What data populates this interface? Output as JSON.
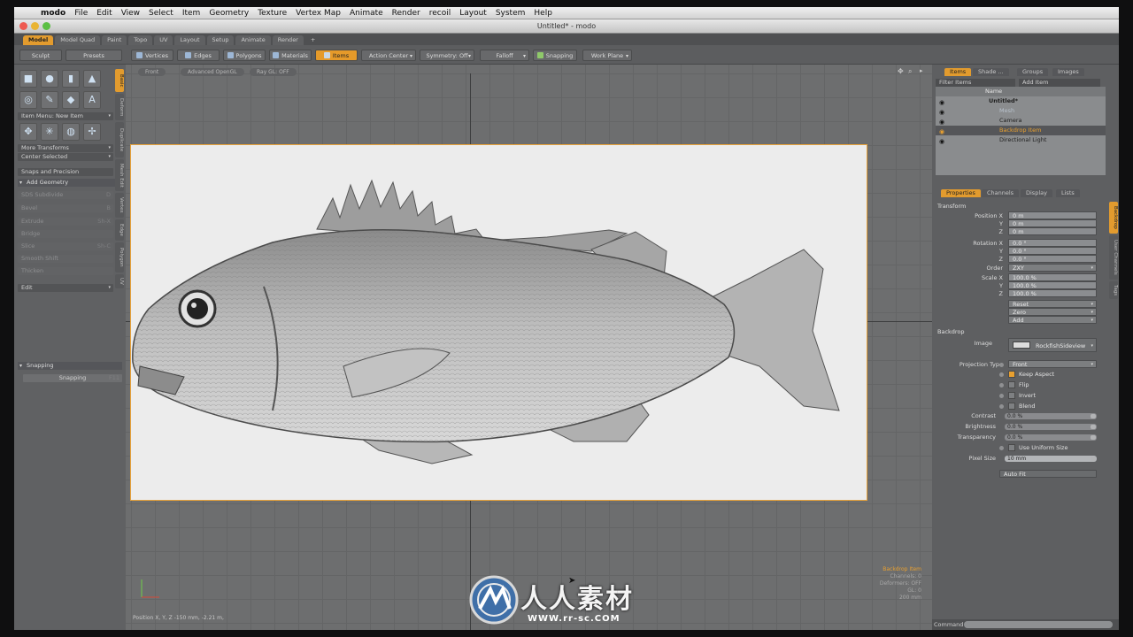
{
  "menubar": {
    "app_name": "modo",
    "items": [
      "File",
      "Edit",
      "View",
      "Select",
      "Item",
      "Geometry",
      "Texture",
      "Vertex Map",
      "Animate",
      "Render",
      "recoil",
      "Layout",
      "System",
      "Help"
    ]
  },
  "window": {
    "title": "Untitled* - modo"
  },
  "layout_tabs": [
    "Model",
    "Model Quad",
    "Paint",
    "Topo",
    "UV",
    "Layout",
    "Setup",
    "Animate",
    "Render"
  ],
  "layout_tab_add": "+",
  "toolbar": {
    "sculpt": "Sculpt",
    "presets": "Presets",
    "vertices": "Vertices",
    "edges": "Edges",
    "polygons": "Polygons",
    "materials": "Materials",
    "items": "Items",
    "action_center": "Action Center",
    "symmetry": "Symmetry: Off",
    "falloff": "Falloff",
    "snapping": "Snapping",
    "work_plane": "Work Plane"
  },
  "left_panel": {
    "item_menu": "Item Menu: New Item",
    "more_transforms": "More Transforms",
    "center_selected": "Center Selected",
    "snaps": "Snaps and Precision",
    "add_geometry": "Add Geometry",
    "tools": [
      [
        "SDS Subdivide",
        "D"
      ],
      [
        "Bevel",
        "B"
      ],
      [
        "Extrude",
        "Sh-X"
      ],
      [
        "Bridge",
        ""
      ],
      [
        "Slice",
        "Sh-C"
      ],
      [
        "Smooth Shift",
        ""
      ],
      [
        "Thicken",
        ""
      ]
    ],
    "edit": "Edit",
    "snapping_section": "Snapping",
    "snapping_row": "Snapping",
    "snapping_key": "F11",
    "side_tabs": [
      "Basic",
      "Deform",
      "Duplicate",
      "Mesh Edit",
      "Vertex",
      "Edge",
      "Polygon",
      "UV"
    ]
  },
  "viewport": {
    "view": "Front",
    "shading": "Advanced OpenGL",
    "ray": "Ray GL: OFF",
    "info_title": "Backdrop Item",
    "info_lines": [
      "Channels: 0",
      "Deformers: OFF",
      "GL: 0",
      "200 mm"
    ],
    "status": "Position X, Y, Z   -150 mm, -2.21 m,"
  },
  "right_panel": {
    "top_tabs": [
      "Items",
      "Shade ...",
      "Groups",
      "Images"
    ],
    "filter": "Filter Items",
    "add_item": "Add Item",
    "list_header": "Name",
    "items": [
      {
        "name": "Untitled*"
      },
      {
        "name": "Mesh"
      },
      {
        "name": "Camera"
      },
      {
        "name": "Backdrop Item"
      },
      {
        "name": "Directional Light"
      }
    ],
    "prop_tabs": [
      "Properties",
      "Channels",
      "Display",
      "Lists"
    ],
    "transform": "Transform",
    "position_x": "Position X",
    "position_x_val": "0 m",
    "y": "Y",
    "pos_y_val": "0 m",
    "z": "Z",
    "pos_z_val": "0 m",
    "rotation_x": "Rotation X",
    "rot_x_val": "0.0 °",
    "rot_y_val": "0.0 °",
    "rot_z_val": "0.0 °",
    "order": "Order",
    "order_val": "ZXY",
    "scale_x": "Scale X",
    "scale_x_val": "100.0 %",
    "scale_y_val": "100.0 %",
    "scale_z_val": "100.0 %",
    "reset": "Reset",
    "zero": "Zero",
    "add": "Add",
    "backdrop_section": "Backdrop",
    "image_label": "Image",
    "image_val": "RockfishSideview",
    "projection_label": "Projection Type",
    "projection_val": "Front",
    "keep_aspect": "Keep Aspect",
    "flip": "Flip",
    "invert": "Invert",
    "blend": "Blend",
    "contrast": "Contrast",
    "contrast_val": "0.0 %",
    "brightness": "Brightness",
    "brightness_val": "0.0 %",
    "transparency": "Transparency",
    "transparency_val": "0.0 %",
    "use_uniform": "Use Uniform Size",
    "pixel_size": "Pixel Size",
    "pixel_size_val": "10 mm",
    "auto_fit": "Auto Fit",
    "side_tabs": [
      "Backdrop",
      "User Channels",
      "Tags"
    ],
    "command": "Command"
  },
  "watermark": {
    "text": "人人素材",
    "url": "WWW.rr-sc.COM"
  },
  "colors": {
    "accent": "#e29b2e",
    "viewport": "#6d6e6f",
    "panel": "#5e5f61"
  }
}
